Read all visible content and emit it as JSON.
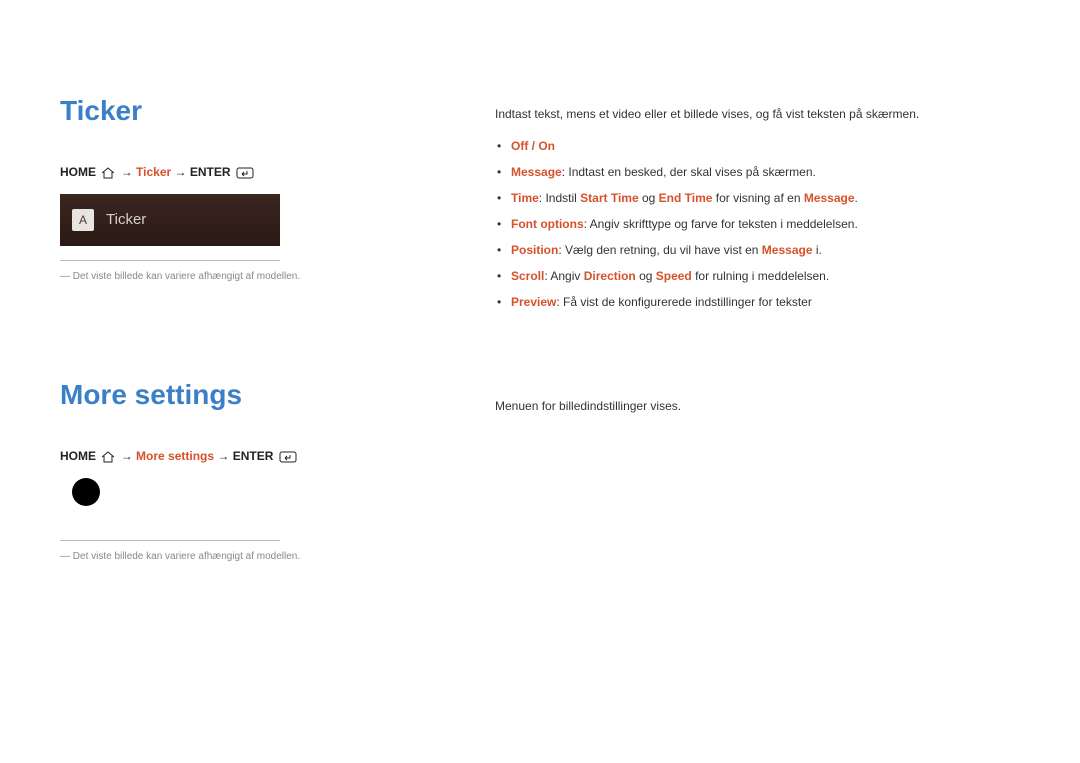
{
  "ticker": {
    "title": "Ticker",
    "nav": {
      "home": "HOME",
      "mid": "Ticker",
      "enter": "ENTER"
    },
    "screenshot": {
      "badge": "A",
      "label": "Ticker"
    },
    "footnote": "Det viste billede kan variere afhængigt af modellen.",
    "intro": "Indtast tekst, mens et video eller et billede vises, og få vist teksten på skærmen.",
    "bullets": {
      "off": "Off",
      "on": "On",
      "message_label": "Message",
      "message_rest": ": Indtast en besked, der skal vises på skærmen.",
      "time_label": "Time",
      "time_pre": ": Indstil ",
      "time_start": "Start Time",
      "time_og": " og ",
      "time_end": "End Time",
      "time_post": " for visning af en ",
      "time_msg": "Message",
      "font_label": "Font options",
      "font_rest": ": Angiv skrifttype og farve for teksten i meddelelsen.",
      "pos_label": "Position",
      "pos_pre": ":  Vælg den retning, du vil have vist en ",
      "pos_msg": "Message",
      "pos_post": " i.",
      "scroll_label": "Scroll",
      "scroll_pre": ": Angiv ",
      "scroll_dir": "Direction",
      "scroll_og": " og ",
      "scroll_speed": "Speed",
      "scroll_post": " for rulning i meddelelsen.",
      "preview_label": "Preview",
      "preview_rest": ": Få vist de konfigurerede indstillinger for tekster"
    }
  },
  "more": {
    "title": "More settings",
    "nav": {
      "home": "HOME",
      "mid": "More settings",
      "enter": "ENTER"
    },
    "footnote": "Det viste billede kan variere afhængigt af modellen.",
    "intro": "Menuen for billedindstillinger vises."
  }
}
